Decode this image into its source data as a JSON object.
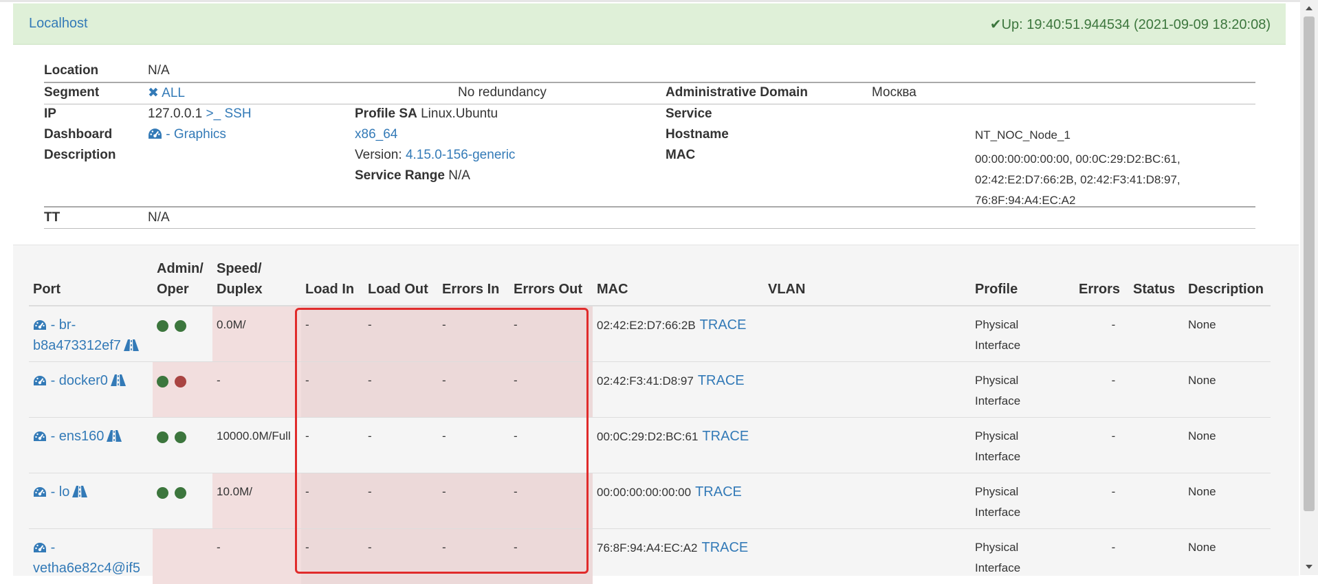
{
  "header": {
    "title": "Localhost",
    "uptime_icon": "✔",
    "uptime": "Up: 19:40:51.944534 (2021-09-09 18:20:08)"
  },
  "info": {
    "location_label": "Location",
    "location_value": "N/A",
    "segment_label": "Segment",
    "segment_icon": "✖",
    "segment_value": "ALL",
    "redundancy": "No redundancy",
    "admin_domain_label": "Administrative Domain",
    "admin_domain_value": "Москва",
    "ip_label": "IP",
    "ip_value": "127.0.0.1",
    "ssh_label": ">_ SSH",
    "profile_sa_label": "Profile SA",
    "profile_sa_value": "Linux.Ubuntu",
    "service_label": "Service",
    "dashboard_label": "Dashboard",
    "graphics_link": "- Graphics",
    "platform": "x86_64",
    "hostname_label": "Hostname",
    "hostname_value": "NT_NOC_Node_1",
    "description_label": "Description",
    "version_label": "Version:",
    "version_value": "4.15.0-156-generic",
    "mac_label": "MAC",
    "mac_lines": [
      "00:00:00:00:00:00, 00:0C:29:D2:BC:61,",
      "02:42:E2:D7:66:2B, 02:42:F3:41:D8:97,",
      "76:8F:94:A4:EC:A2"
    ],
    "service_range_label": "Service Range",
    "service_range_value": "N/A",
    "tt_label": "TT",
    "tt_value": "N/A"
  },
  "ports": {
    "columns": {
      "port": "Port",
      "admin1": "Admin/",
      "admin2": "Oper",
      "speed1": "Speed/",
      "speed2": "Duplex",
      "load_in": "Load In",
      "load_out": "Load Out",
      "errors_in": "Errors In",
      "errors_out": "Errors Out",
      "mac": "MAC",
      "vlan": "VLAN",
      "profile": "Profile",
      "errors": "Errors",
      "status": "Status",
      "description": "Description"
    },
    "rows": [
      {
        "name_a": "- br-",
        "name_b": "b8a473312ef7",
        "admin": "up",
        "oper": "up",
        "speed": "0.0M/",
        "load_in": "-",
        "load_out": "-",
        "errors_in": "-",
        "errors_out": "-",
        "mac": "02:42:E2:D7:66:2B",
        "trace": "TRACE",
        "profile_a": "Physical",
        "profile_b": "Interface",
        "errors": "-",
        "description": "None"
      },
      {
        "name_a": "- docker0",
        "name_b": "",
        "admin": "up",
        "oper": "down",
        "speed": "-",
        "load_in": "-",
        "load_out": "-",
        "errors_in": "-",
        "errors_out": "-",
        "mac": "02:42:F3:41:D8:97",
        "trace": "TRACE",
        "profile_a": "Physical",
        "profile_b": "Interface",
        "errors": "-",
        "description": "None"
      },
      {
        "name_a": "- ens160",
        "name_b": "",
        "admin": "up",
        "oper": "up",
        "speed": "10000.0M/Full",
        "load_in": "-",
        "load_out": "-",
        "errors_in": "-",
        "errors_out": "-",
        "mac": "00:0C:29:D2:BC:61",
        "trace": "TRACE",
        "profile_a": "Physical",
        "profile_b": "Interface",
        "errors": "-",
        "description": "None"
      },
      {
        "name_a": "- lo",
        "name_b": "",
        "admin": "up",
        "oper": "up",
        "speed": "10.0M/",
        "load_in": "-",
        "load_out": "-",
        "errors_in": "-",
        "errors_out": "-",
        "mac": "00:00:00:00:00:00",
        "trace": "TRACE",
        "profile_a": "Physical",
        "profile_b": "Interface",
        "errors": "-",
        "description": "None"
      },
      {
        "name_a": "-",
        "name_b": "vetha6e82c4@if5",
        "admin": "",
        "oper": "",
        "speed": "-",
        "load_in": "-",
        "load_out": "-",
        "errors_in": "-",
        "errors_out": "-",
        "mac": "76:8F:94:A4:EC:A2",
        "trace": "TRACE",
        "profile_a": "Physical",
        "profile_b": "Interface",
        "errors": "-",
        "description": "None"
      }
    ]
  },
  "colors": {
    "header_bg": "#dff0d8",
    "up_text": "#3c763d",
    "link": "#337ab7",
    "status_up": "#3c763d",
    "status_down": "#a94442",
    "row_alert": "#f2dede",
    "highlight_box": "#e02b2b"
  },
  "icons": {
    "dashboard": "dashboard-icon",
    "road": "road-icon",
    "check": "check-icon",
    "times": "times-icon"
  }
}
